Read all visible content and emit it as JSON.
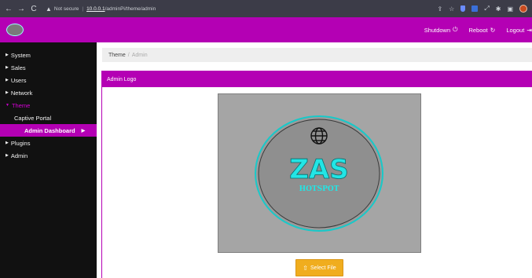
{
  "browser": {
    "back_icon": "arrow-left-icon",
    "forward_icon": "arrow-right-icon",
    "reload_icon": "reload-icon",
    "security_label": "Not secure",
    "url_host": "10.0.0.1",
    "url_path": "/adminPi/theme/admin"
  },
  "header": {
    "shutdown_label": "Shutdown",
    "reboot_label": "Reboot",
    "logout_label": "Logout"
  },
  "sidebar": {
    "items": [
      {
        "label": "System"
      },
      {
        "label": "Sales"
      },
      {
        "label": "Users"
      },
      {
        "label": "Network"
      },
      {
        "label": "Theme"
      },
      {
        "label": "Captive Portal"
      },
      {
        "label": "Admin Dashboard"
      },
      {
        "label": "Plugins"
      },
      {
        "label": "Admin"
      }
    ]
  },
  "breadcrumb": {
    "parent": "Theme",
    "separator": "/",
    "current": "Admin"
  },
  "panel": {
    "title": "Admin Logo",
    "logo_text": "ZAS",
    "logo_subtext": "HOTSPOT",
    "button_label": "Select File"
  },
  "colors": {
    "brand": "#b400b4",
    "sidebar_bg": "#111111",
    "logo_text": "#22e5e5",
    "button": "#f0ad1e"
  }
}
